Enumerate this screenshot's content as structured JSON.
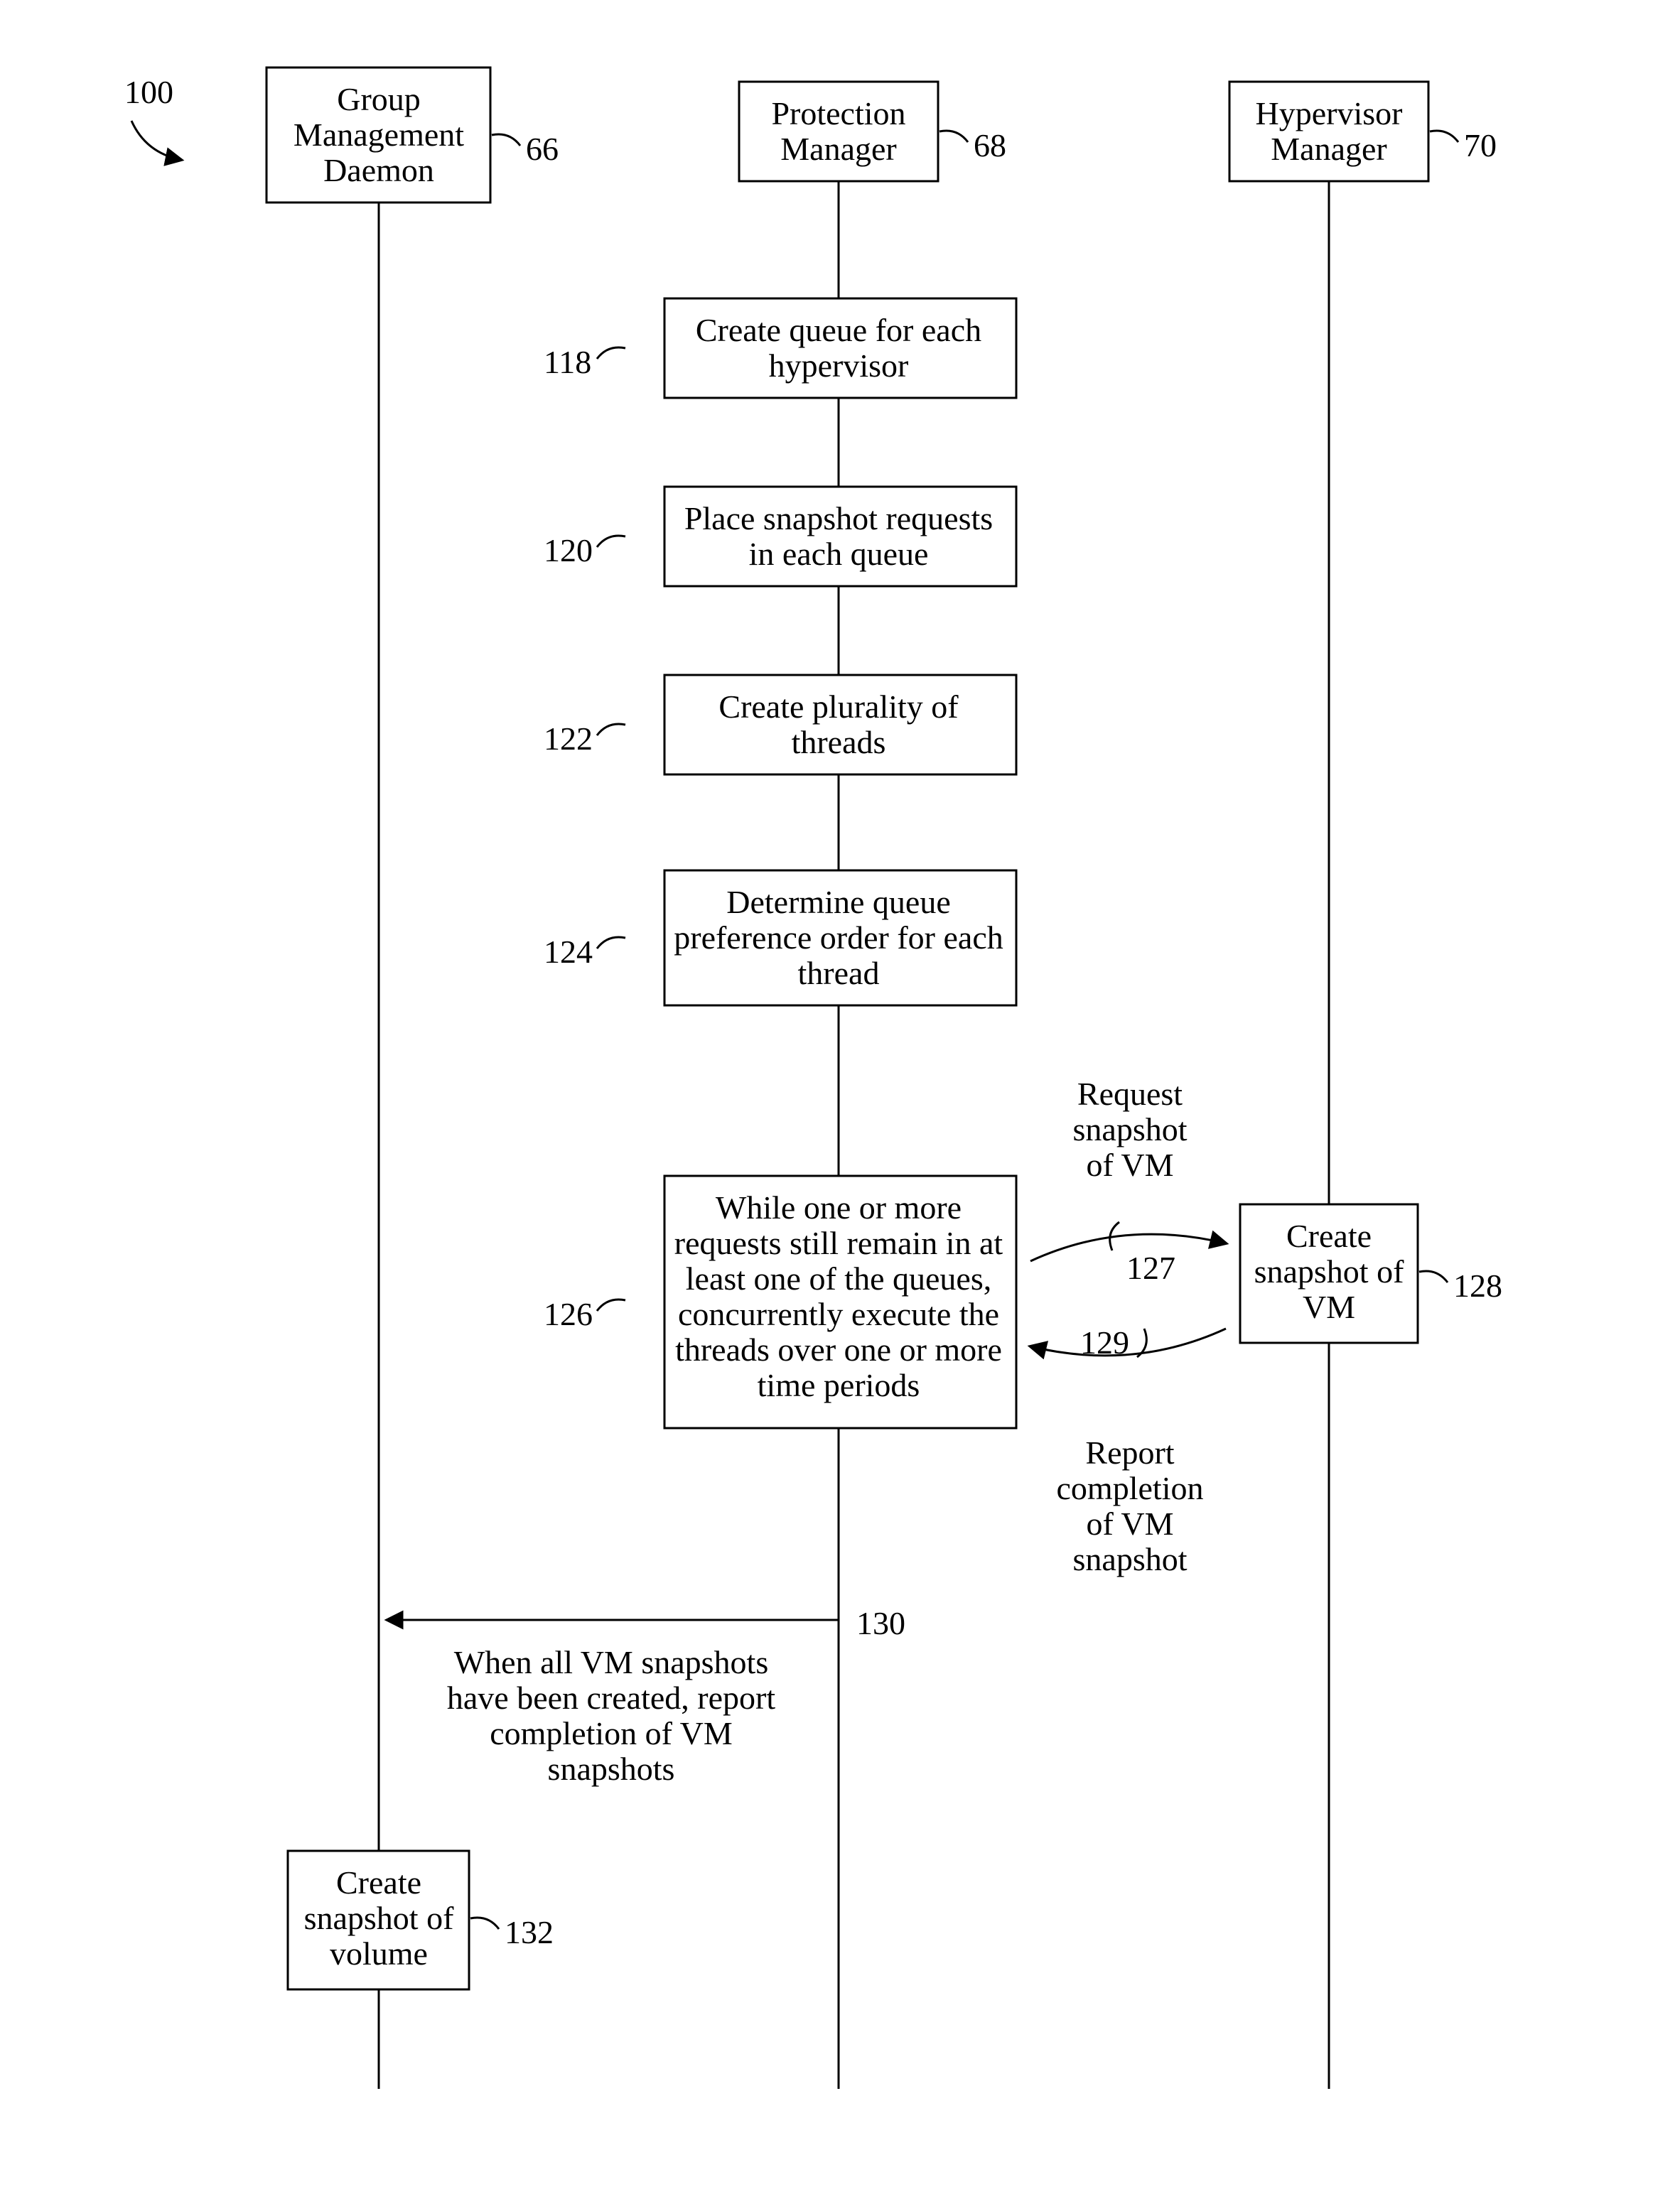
{
  "figure_ref": "100",
  "lanes": {
    "gmd": {
      "title_l1": "Group",
      "title_l2": "Management",
      "title_l3": "Daemon",
      "ref": "66"
    },
    "pm": {
      "title_l1": "Protection",
      "title_l2": "Manager",
      "ref": "68"
    },
    "hm": {
      "title_l1": "Hypervisor",
      "title_l2": "Manager",
      "ref": "70"
    }
  },
  "steps": {
    "s118": {
      "ref": "118",
      "l1": "Create queue for each",
      "l2": "hypervisor"
    },
    "s120": {
      "ref": "120",
      "l1": "Place snapshot requests",
      "l2": "in each queue"
    },
    "s122": {
      "ref": "122",
      "l1": "Create plurality of",
      "l2": "threads"
    },
    "s124": {
      "ref": "124",
      "l1": "Determine queue",
      "l2": "preference order for each",
      "l3": "thread"
    },
    "s126": {
      "ref": "126",
      "l1": "While one or more",
      "l2": "requests still remain in at",
      "l3": "least one of the queues,",
      "l4": "concurrently execute the",
      "l5": "threads over one or more",
      "l6": "time periods"
    },
    "s128": {
      "ref": "128",
      "l1": "Create",
      "l2": "snapshot of",
      "l3": "VM"
    },
    "s132": {
      "ref": "132",
      "l1": "Create",
      "l2": "snapshot of",
      "l3": "volume"
    }
  },
  "messages": {
    "m127": {
      "ref": "127",
      "l1": "Request",
      "l2": "snapshot",
      "l3": "of VM"
    },
    "m129": {
      "ref": "129",
      "l1": "Report",
      "l2": "completion",
      "l3": "of VM",
      "l4": "snapshot"
    },
    "m130": {
      "ref": "130",
      "l1": "When all VM snapshots",
      "l2": "have been created, report",
      "l3": "completion of VM",
      "l4": "snapshots"
    }
  }
}
